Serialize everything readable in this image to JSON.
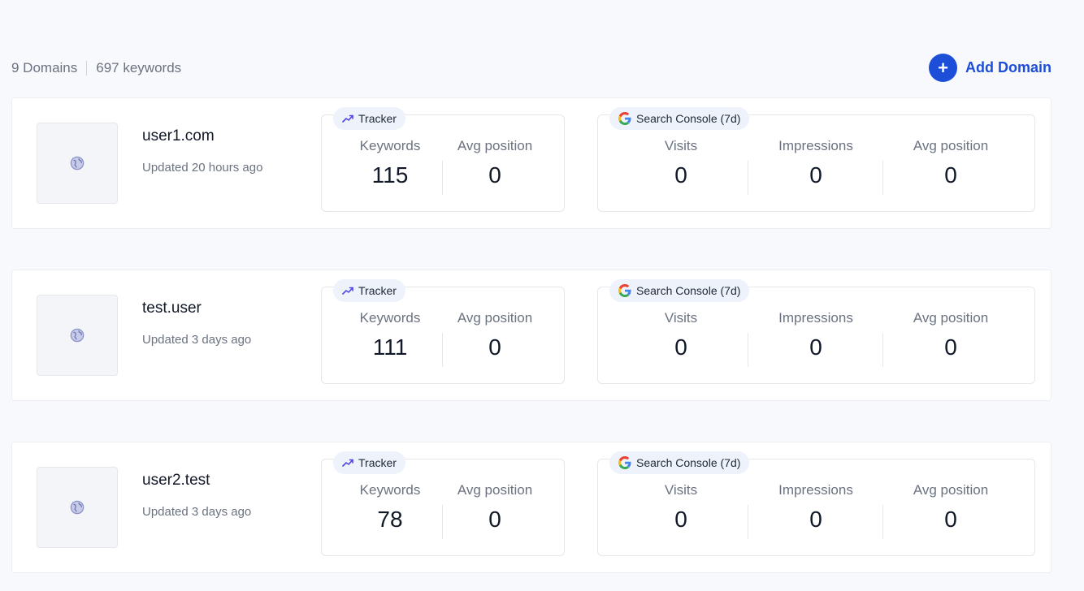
{
  "summary": {
    "domains": "9 Domains",
    "keywords": "697 keywords"
  },
  "actions": {
    "add_domain_label": "Add Domain",
    "add_icon": "+"
  },
  "labels": {
    "tracker": "Tracker",
    "search_console": "Search Console (7d)",
    "keywords": "Keywords",
    "avg_position": "Avg position",
    "visits": "Visits",
    "impressions": "Impressions"
  },
  "colors": {
    "accent": "#1d4ed8",
    "tracker_icon": "#4f46e5"
  },
  "domains": [
    {
      "name": "user1.com",
      "updated": "Updated 20 hours ago",
      "tracker": {
        "keywords": "115",
        "avg_position": "0"
      },
      "gsc": {
        "visits": "0",
        "impressions": "0",
        "avg_position": "0"
      }
    },
    {
      "name": "test.user",
      "updated": "Updated 3 days ago",
      "tracker": {
        "keywords": "111",
        "avg_position": "0"
      },
      "gsc": {
        "visits": "0",
        "impressions": "0",
        "avg_position": "0"
      }
    },
    {
      "name": "user2.test",
      "updated": "Updated 3 days ago",
      "tracker": {
        "keywords": "78",
        "avg_position": "0"
      },
      "gsc": {
        "visits": "0",
        "impressions": "0",
        "avg_position": "0"
      }
    }
  ]
}
